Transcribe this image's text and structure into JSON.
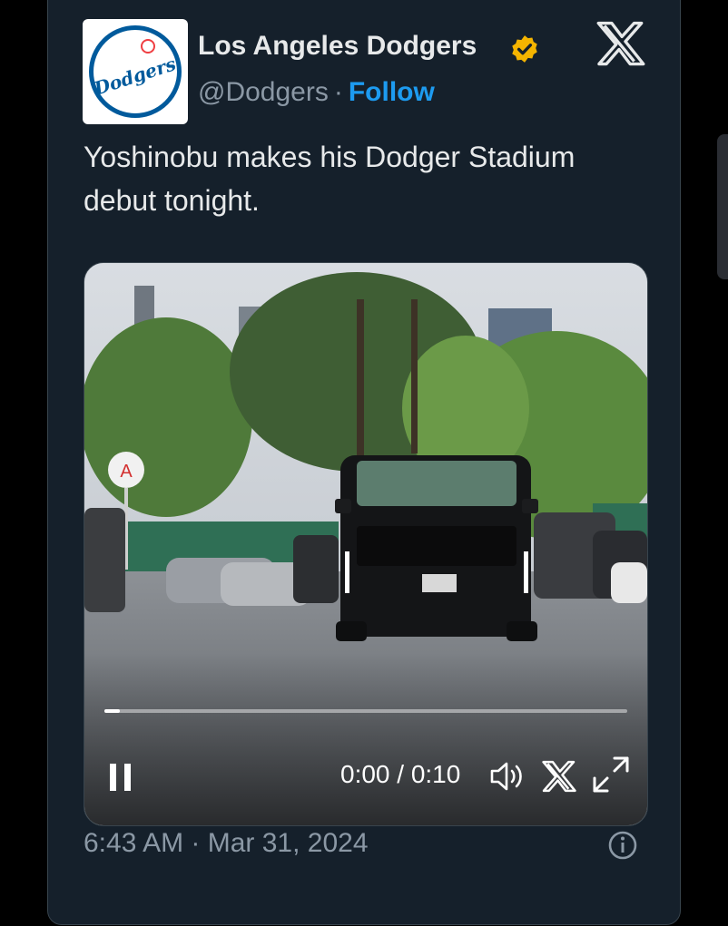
{
  "tweet": {
    "account_name": "Los Angeles Dodgers",
    "handle": "@Dodgers",
    "separator": "·",
    "follow_label": "Follow",
    "text": "Yoshinobu makes his Dodger Stadium debut tonight.",
    "timestamp": "6:43 AM · Mar 31, 2024",
    "avatar_word": "Dodgers",
    "verified_badge_color": "#f4b400",
    "icons": {
      "verified": "verified-badge-icon",
      "platform": "x-logo-icon",
      "info": "info-icon"
    }
  },
  "video": {
    "time_display": "0:00 / 0:10",
    "progress": 0.03,
    "controls": [
      "pause-icon",
      "volume-icon",
      "x-logo-icon",
      "fullscreen-icon"
    ],
    "sign_letter": "A"
  },
  "colors": {
    "card_background": "#15202b",
    "text_primary": "#e7e9ea",
    "text_secondary": "#8b98a5",
    "accent": "#1d9bf0"
  }
}
